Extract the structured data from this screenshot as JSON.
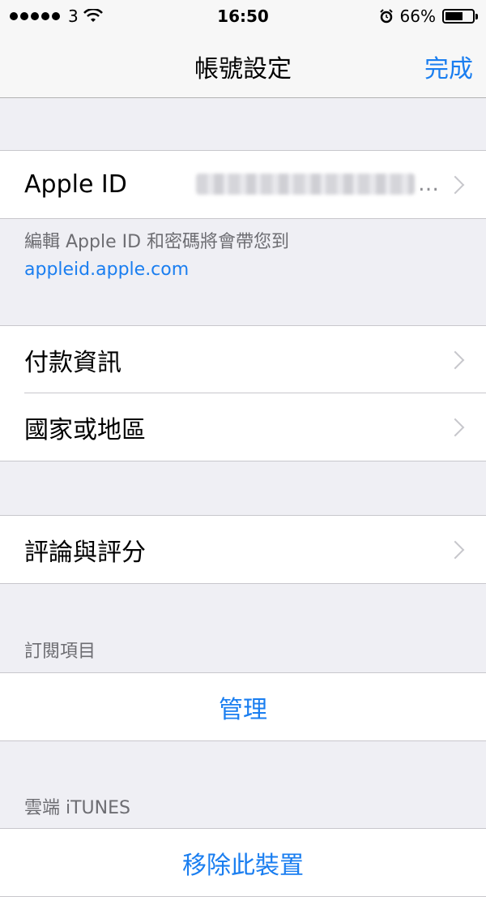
{
  "status_bar": {
    "carrier": "3",
    "time": "16:50",
    "battery": "66%",
    "battery_level": 0.66
  },
  "nav": {
    "title": "帳號設定",
    "done_label": "完成"
  },
  "apple_id": {
    "label": "Apple ID",
    "ellipsis": "…"
  },
  "apple_id_footer": {
    "text": "編輯 Apple ID 和密碼將會帶您到",
    "link": "appleid.apple.com"
  },
  "payment": {
    "label": "付款資訊"
  },
  "country": {
    "label": "國家或地區"
  },
  "ratings": {
    "label": "評論與評分"
  },
  "subscriptions": {
    "header": "訂閱項目",
    "manage_label": "管理"
  },
  "itunes_cloud": {
    "header": "雲端 iTUNES",
    "remove_label": "移除此裝置"
  },
  "colors": {
    "accent": "#1a7ef0",
    "background": "#efeff4",
    "secondary_text": "#6d6d72"
  }
}
